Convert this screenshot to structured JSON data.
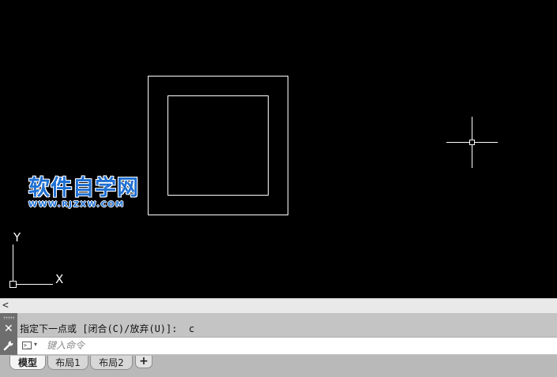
{
  "watermark": {
    "title": "软件自学网",
    "url": "WWW.RJZXW.COM"
  },
  "ucs": {
    "x_label": "X",
    "y_label": "Y"
  },
  "scrollbar": {
    "left_arrow": "<"
  },
  "command_line": {
    "close_glyph": "✕",
    "history": "指定下一点或 [闭合(C)/放弃(U)]:  c",
    "prompt_glyph": ">_",
    "caret_glyph": "▾",
    "input_value": "",
    "input_placeholder": "键入命令"
  },
  "layout_tabs": [
    {
      "label": "模型",
      "active": true
    },
    {
      "label": "布局1",
      "active": false
    },
    {
      "label": "布局2",
      "active": false
    }
  ],
  "add_tab_label": "+",
  "colors": {
    "canvas_bg": "#000000",
    "drawing_lines": "#ffffff",
    "watermark_blue": "#1e6fd1"
  }
}
